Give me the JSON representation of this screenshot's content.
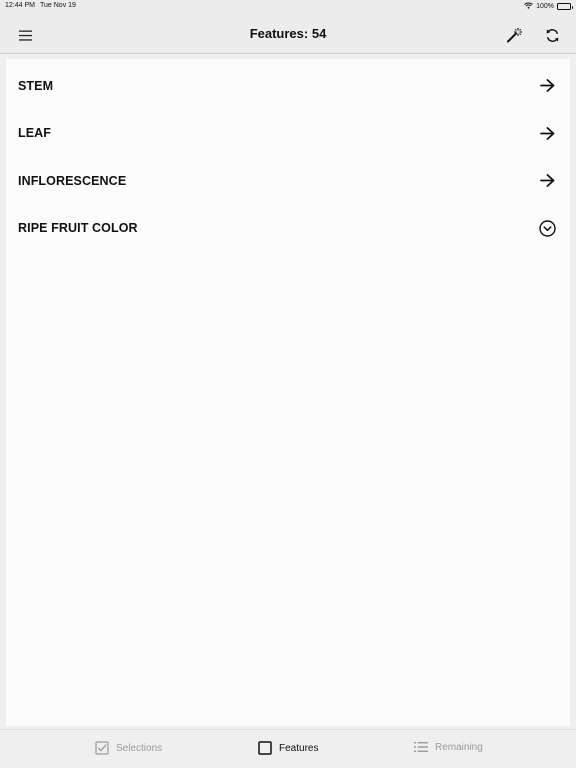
{
  "status_bar": {
    "time": "12:44 PM",
    "date": "Tue Nov 19",
    "battery": "100%",
    "icons": [
      "wifi-icon",
      "battery-icon"
    ]
  },
  "nav": {
    "title": "Features: 54",
    "left_icon": "menu-icon",
    "right_icons": [
      "magic-wand-icon",
      "refresh-icon"
    ]
  },
  "features": [
    {
      "label": "STEM",
      "icon": "arrow-right-icon"
    },
    {
      "label": "LEAF",
      "icon": "arrow-right-icon"
    },
    {
      "label": "INFLORESCENCE",
      "icon": "arrow-right-icon"
    },
    {
      "label": "RIPE FRUIT COLOR",
      "icon": "chevron-down-circle-icon"
    }
  ],
  "tabs": [
    {
      "label": "Selections",
      "icon": "checkbox-checked-icon",
      "active": false
    },
    {
      "label": "Features",
      "icon": "checkbox-empty-icon",
      "active": true
    },
    {
      "label": "Remaining",
      "icon": "list-icon",
      "active": false
    }
  ],
  "colors": {
    "bar_background": "#ececec",
    "content_background": "#fcfcfc",
    "inactive_tab": "#9a9a9a",
    "text": "#111111"
  }
}
